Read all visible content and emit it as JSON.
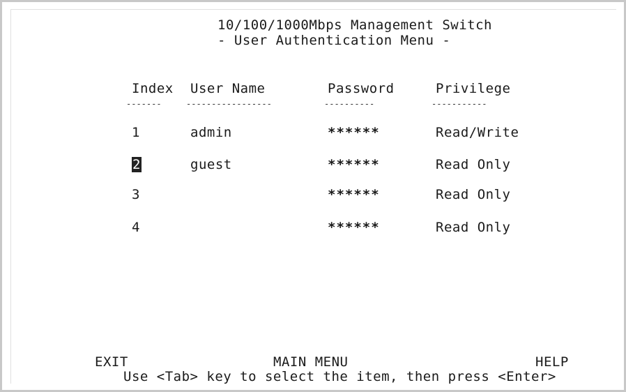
{
  "header": {
    "title": "10/100/1000Mbps Management Switch",
    "subtitle": "- User Authentication Menu -"
  },
  "table": {
    "columns": [
      "Index",
      "User Name",
      "Password",
      "Privilege"
    ],
    "underlines": [
      "-------",
      "-----------------",
      "----------",
      "-----------"
    ],
    "rows": [
      {
        "index": "1",
        "user": "admin",
        "password": "******",
        "privilege": "Read/Write"
      },
      {
        "index": "2",
        "user": "guest",
        "password": "******",
        "privilege": "Read Only"
      },
      {
        "index": "3",
        "user": "",
        "password": "******",
        "privilege": "Read Only"
      },
      {
        "index": "4",
        "user": "",
        "password": "******",
        "privilege": "Read Only"
      }
    ]
  },
  "footer": {
    "exit": "EXIT",
    "main_menu": "MAIN MENU",
    "help": "HELP",
    "hint": "Use <Tab> key to select the item, then press <Enter>"
  }
}
